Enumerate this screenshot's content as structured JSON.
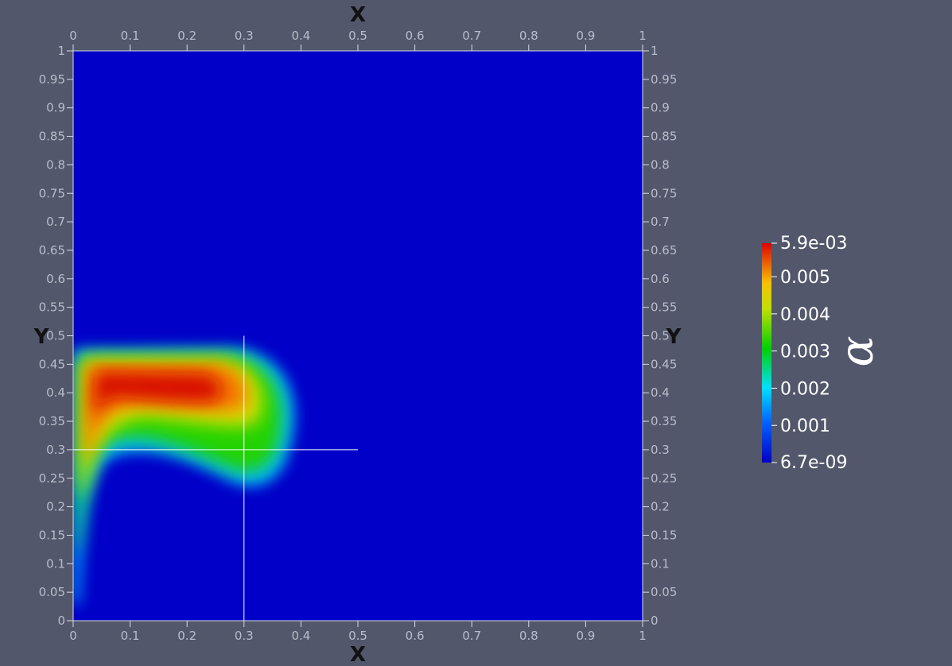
{
  "chart_data": {
    "type": "heatmap",
    "title": "",
    "xlabel": "X",
    "ylabel": "Y",
    "xlim": [
      0,
      1
    ],
    "ylim": [
      0,
      1
    ],
    "x_ticks": [
      "0",
      "0.1",
      "0.2",
      "0.3",
      "0.4",
      "0.5",
      "0.6",
      "0.7",
      "0.8",
      "0.9",
      "1"
    ],
    "y_ticks": [
      "0",
      "0.05",
      "0.1",
      "0.15",
      "0.2",
      "0.25",
      "0.3",
      "0.35",
      "0.4",
      "0.45",
      "0.5",
      "0.55",
      "0.6",
      "0.65",
      "0.7",
      "0.75",
      "0.8",
      "0.85",
      "0.9",
      "0.95",
      "1"
    ],
    "field_feature": {
      "description": "concentrated region along left wall, arching to the right near y=0.4",
      "max_location": [
        0.12,
        0.42
      ],
      "extent_x": [
        0.0,
        0.38
      ],
      "extent_y": [
        0.24,
        0.48
      ]
    },
    "crosshair": {
      "x": 0.3,
      "y": 0.3
    },
    "colorbar": {
      "title": "α",
      "min_label": "6.7e-09",
      "max_label": "5.9e-03",
      "tick_labels": [
        "0.005",
        "0.004",
        "0.003",
        "0.002",
        "0.001"
      ],
      "tick_values": [
        0.005,
        0.004,
        0.003,
        0.002,
        0.001
      ],
      "min": 6.7e-09,
      "max": 0.0059,
      "colormap": [
        "#0000c8",
        "#00c8ff",
        "#00d000",
        "#f0e000",
        "#ff0000"
      ]
    }
  },
  "colors": {
    "background": "#52576b",
    "field_low": "#0000c8",
    "grid_lines": "#ffffff"
  }
}
